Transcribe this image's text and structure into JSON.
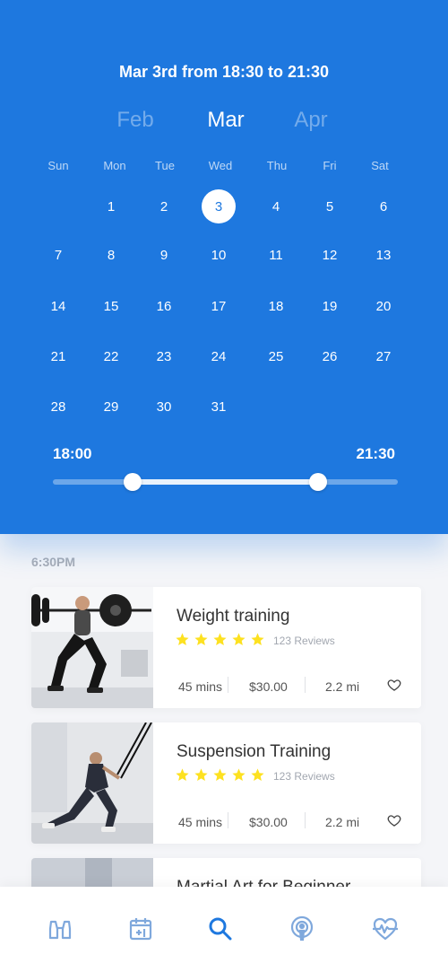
{
  "header": {
    "title": "Mar 3rd from 18:30 to 21:30",
    "months": {
      "prev": "Feb",
      "current": "Mar",
      "next": "Apr"
    },
    "weekdays": [
      "Sun",
      "Mon",
      "Tue",
      "Wed",
      "Thu",
      "Fri",
      "Sat"
    ],
    "days": [
      "1",
      "2",
      "3",
      "4",
      "5",
      "6",
      "7",
      "8",
      "9",
      "10",
      "11",
      "12",
      "13",
      "14",
      "15",
      "16",
      "17",
      "18",
      "19",
      "20",
      "21",
      "22",
      "23",
      "24",
      "25",
      "26",
      "27",
      "28",
      "29",
      "30",
      "31"
    ],
    "selected_day": "3",
    "range": {
      "start_label": "18:00",
      "end_label": "21:30",
      "start_fraction": 0.23,
      "end_fraction": 0.77
    }
  },
  "list": {
    "section_time": "6:30PM",
    "cards": [
      {
        "title": "Weight training",
        "rating": 5,
        "reviews": "123 Reviews",
        "duration": "45 mins",
        "price": "$30.00",
        "distance": "2.2 mi"
      },
      {
        "title": "Suspension Training",
        "rating": 5,
        "reviews": "123 Reviews",
        "duration": "45 mins",
        "price": "$30.00",
        "distance": "2.2 mi"
      },
      {
        "title": "Martial Art for Beginner"
      }
    ]
  },
  "nav": {
    "items": [
      "binoculars-icon",
      "calendar-plus-icon",
      "search-icon",
      "podcast-icon",
      "heart-pulse-icon"
    ],
    "active": "search-icon"
  },
  "colors": {
    "primary": "#1e78df",
    "star": "#fde120",
    "text": "#333333"
  }
}
